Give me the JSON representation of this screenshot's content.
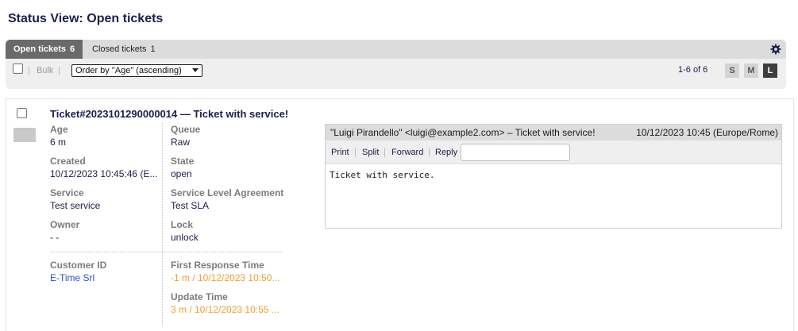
{
  "page": {
    "title": "Status View: Open tickets"
  },
  "tabs": [
    {
      "label": "Open tickets",
      "count": "6",
      "active": true
    },
    {
      "label": "Closed tickets",
      "count": "1",
      "active": false
    }
  ],
  "toolbar": {
    "separator": "|",
    "bulk_label": "Bulk",
    "order_by_selected": "Order by \"Age\" (ascending)",
    "pager_text": "1-6 of 6",
    "size_buttons": [
      "S",
      "M",
      "L"
    ],
    "active_size": "L"
  },
  "ticket": {
    "title": "Ticket#2023101290000014 — Ticket with service!",
    "fields_left": [
      {
        "label": "Age",
        "value": "6 m"
      },
      {
        "label": "Created",
        "value": "10/12/2023 10:45:46 (E..."
      },
      {
        "label": "Service",
        "value": "Test service"
      },
      {
        "label": "Owner",
        "value": "- -"
      },
      {
        "label": "Customer ID",
        "value": "E-Time Srl"
      }
    ],
    "fields_right": [
      {
        "label": "Queue",
        "value": "Raw"
      },
      {
        "label": "State",
        "value": "open"
      },
      {
        "label": "Service Level Agreement",
        "value": "Test SLA"
      },
      {
        "label": "Lock",
        "value": "unlock"
      },
      {
        "label": "First Response Time",
        "value": "-1 m / 10/12/2023 10:50..."
      },
      {
        "label": "Update Time",
        "value": "3 m / 10/12/2023 10:55 ..."
      }
    ],
    "article": {
      "from": "\"Luigi Pirandello\" <luigi@example2.com> – Ticket with service!",
      "date": "10/12/2023 10:45 (Europe/Rome)",
      "actions": [
        "Print",
        "Split",
        "Forward",
        "Reply"
      ],
      "body": "Ticket with service."
    }
  },
  "colors": {
    "accent": "#1b1f4b",
    "link": "#2a4fc9",
    "warning": "#f0a030",
    "active_tab": "#6a6a6a"
  },
  "icons": {
    "settings": "gear-icon"
  }
}
